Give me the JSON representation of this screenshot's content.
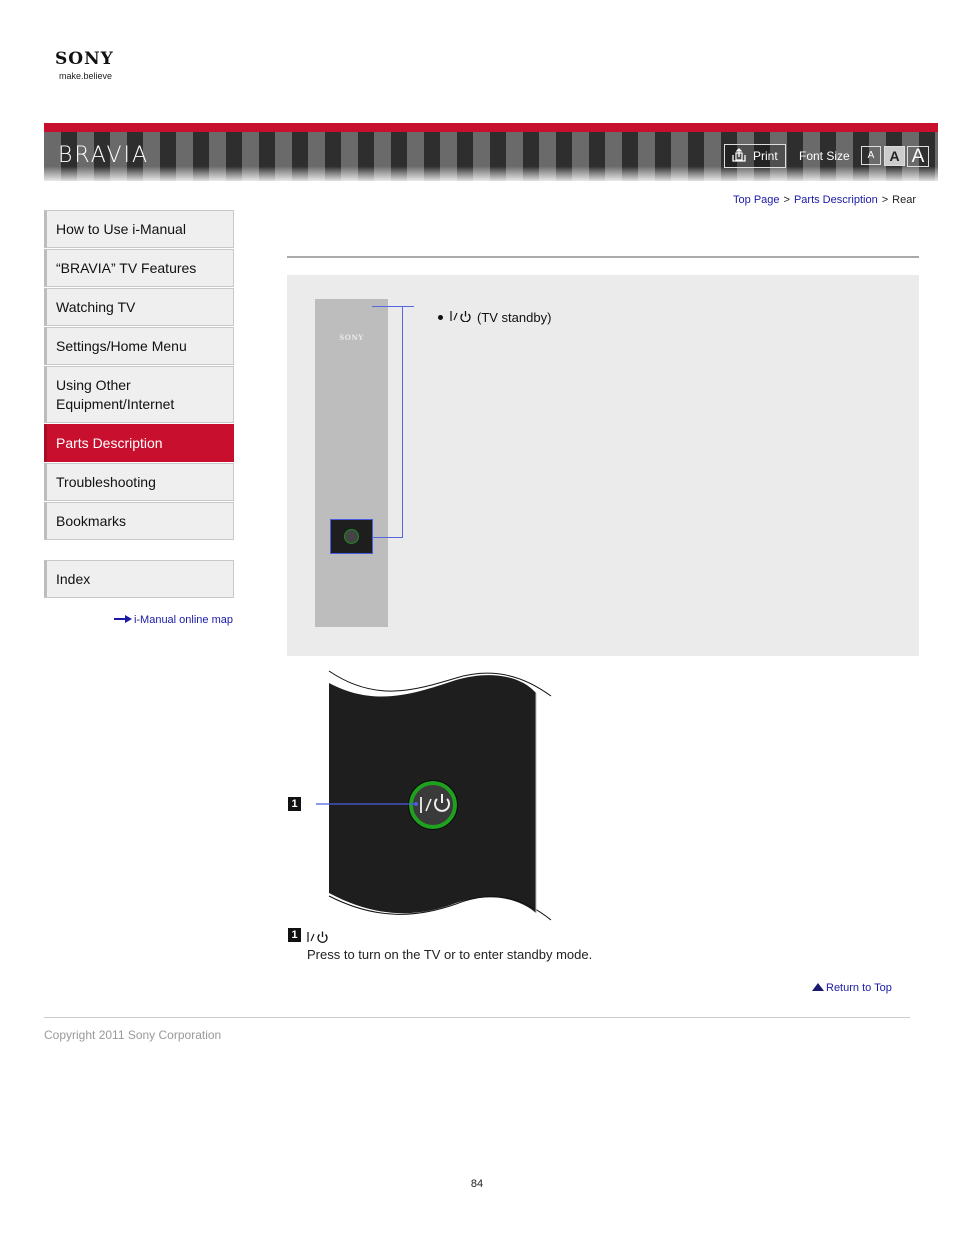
{
  "logo": {
    "brand": "SONY",
    "tagline": "make.believe"
  },
  "header": {
    "product": "BRAVIA",
    "print_label": "Print",
    "font_size_label": "Font Size",
    "font_size_buttons": [
      "A",
      "A",
      "A"
    ],
    "selected_font_size": "medium",
    "accent_color": "#c8102e"
  },
  "breadcrumb": {
    "items": [
      {
        "label": "Top Page",
        "link": true
      },
      {
        "label": "Parts Description",
        "link": true
      },
      {
        "label": "Rear",
        "link": false
      }
    ],
    "separator": ">"
  },
  "sidebar": {
    "items": [
      {
        "label": "How to Use i-Manual",
        "active": false
      },
      {
        "label": "“BRAVIA” TV Features",
        "active": false
      },
      {
        "label": "Watching TV",
        "active": false
      },
      {
        "label": "Settings/Home Menu",
        "active": false
      },
      {
        "label": "Using Other Equipment/Internet",
        "active": false
      },
      {
        "label": "Parts Description",
        "active": true
      },
      {
        "label": "Troubleshooting",
        "active": false
      },
      {
        "label": "Bookmarks",
        "active": false
      }
    ],
    "index_label": "Index",
    "online_map_label": "i-Manual online map"
  },
  "content": {
    "diagram": {
      "tv_logo": "SONY",
      "bullet_symbol": "I/⏻",
      "bullet_label": "(TV standby)"
    },
    "closeup": {
      "callout_number": "1",
      "button_symbol": "I / ⏻"
    },
    "descriptions": [
      {
        "number": "1",
        "symbol": "I/⏻",
        "text": "Press to turn on the TV or to enter standby mode."
      }
    ],
    "return_to_top": "Return to Top"
  },
  "footer": {
    "copyright": "Copyright 2011 Sony Corporation",
    "page_number": "84"
  }
}
